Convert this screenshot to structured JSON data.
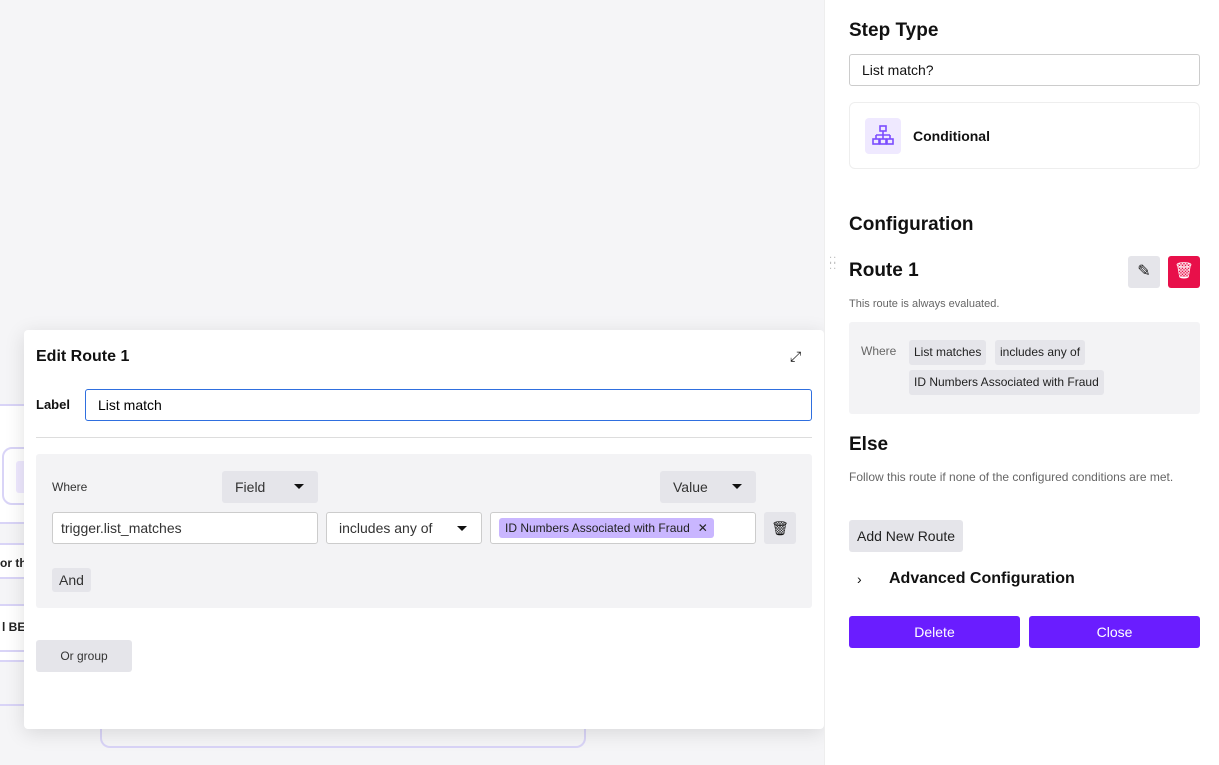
{
  "canvas": {
    "node_text_1": "or th",
    "node_text_2": "l BE"
  },
  "modal": {
    "title": "Edit Route 1",
    "label_caption": "Label",
    "label_value": "List match",
    "where": "Where",
    "field_dropdown": "Field",
    "value_dropdown": "Value",
    "field_value": "trigger.list_matches",
    "operator": "includes any of",
    "value_tag": "ID Numbers Associated with Fraud",
    "and_button": "And",
    "or_group_button": "Or group"
  },
  "panel": {
    "step_type_heading": "Step Type",
    "step_name": "List match?",
    "type_name": "Conditional",
    "configuration_heading": "Configuration",
    "route_title": "Route 1",
    "route_desc": "This route is always evaluated.",
    "where": "Where",
    "cond_field": "List matches",
    "cond_operator": "includes any of",
    "cond_value": "ID Numbers Associated with Fraud",
    "else_heading": "Else",
    "else_desc": "Follow this route if none of the configured conditions are met.",
    "add_route": "Add New Route",
    "advanced": "Advanced Configuration",
    "delete": "Delete",
    "close": "Close"
  },
  "colors": {
    "accent": "#6a1dff",
    "danger": "#e8104a",
    "tag": "#c9b6ff",
    "focus": "#2f6fdf"
  }
}
